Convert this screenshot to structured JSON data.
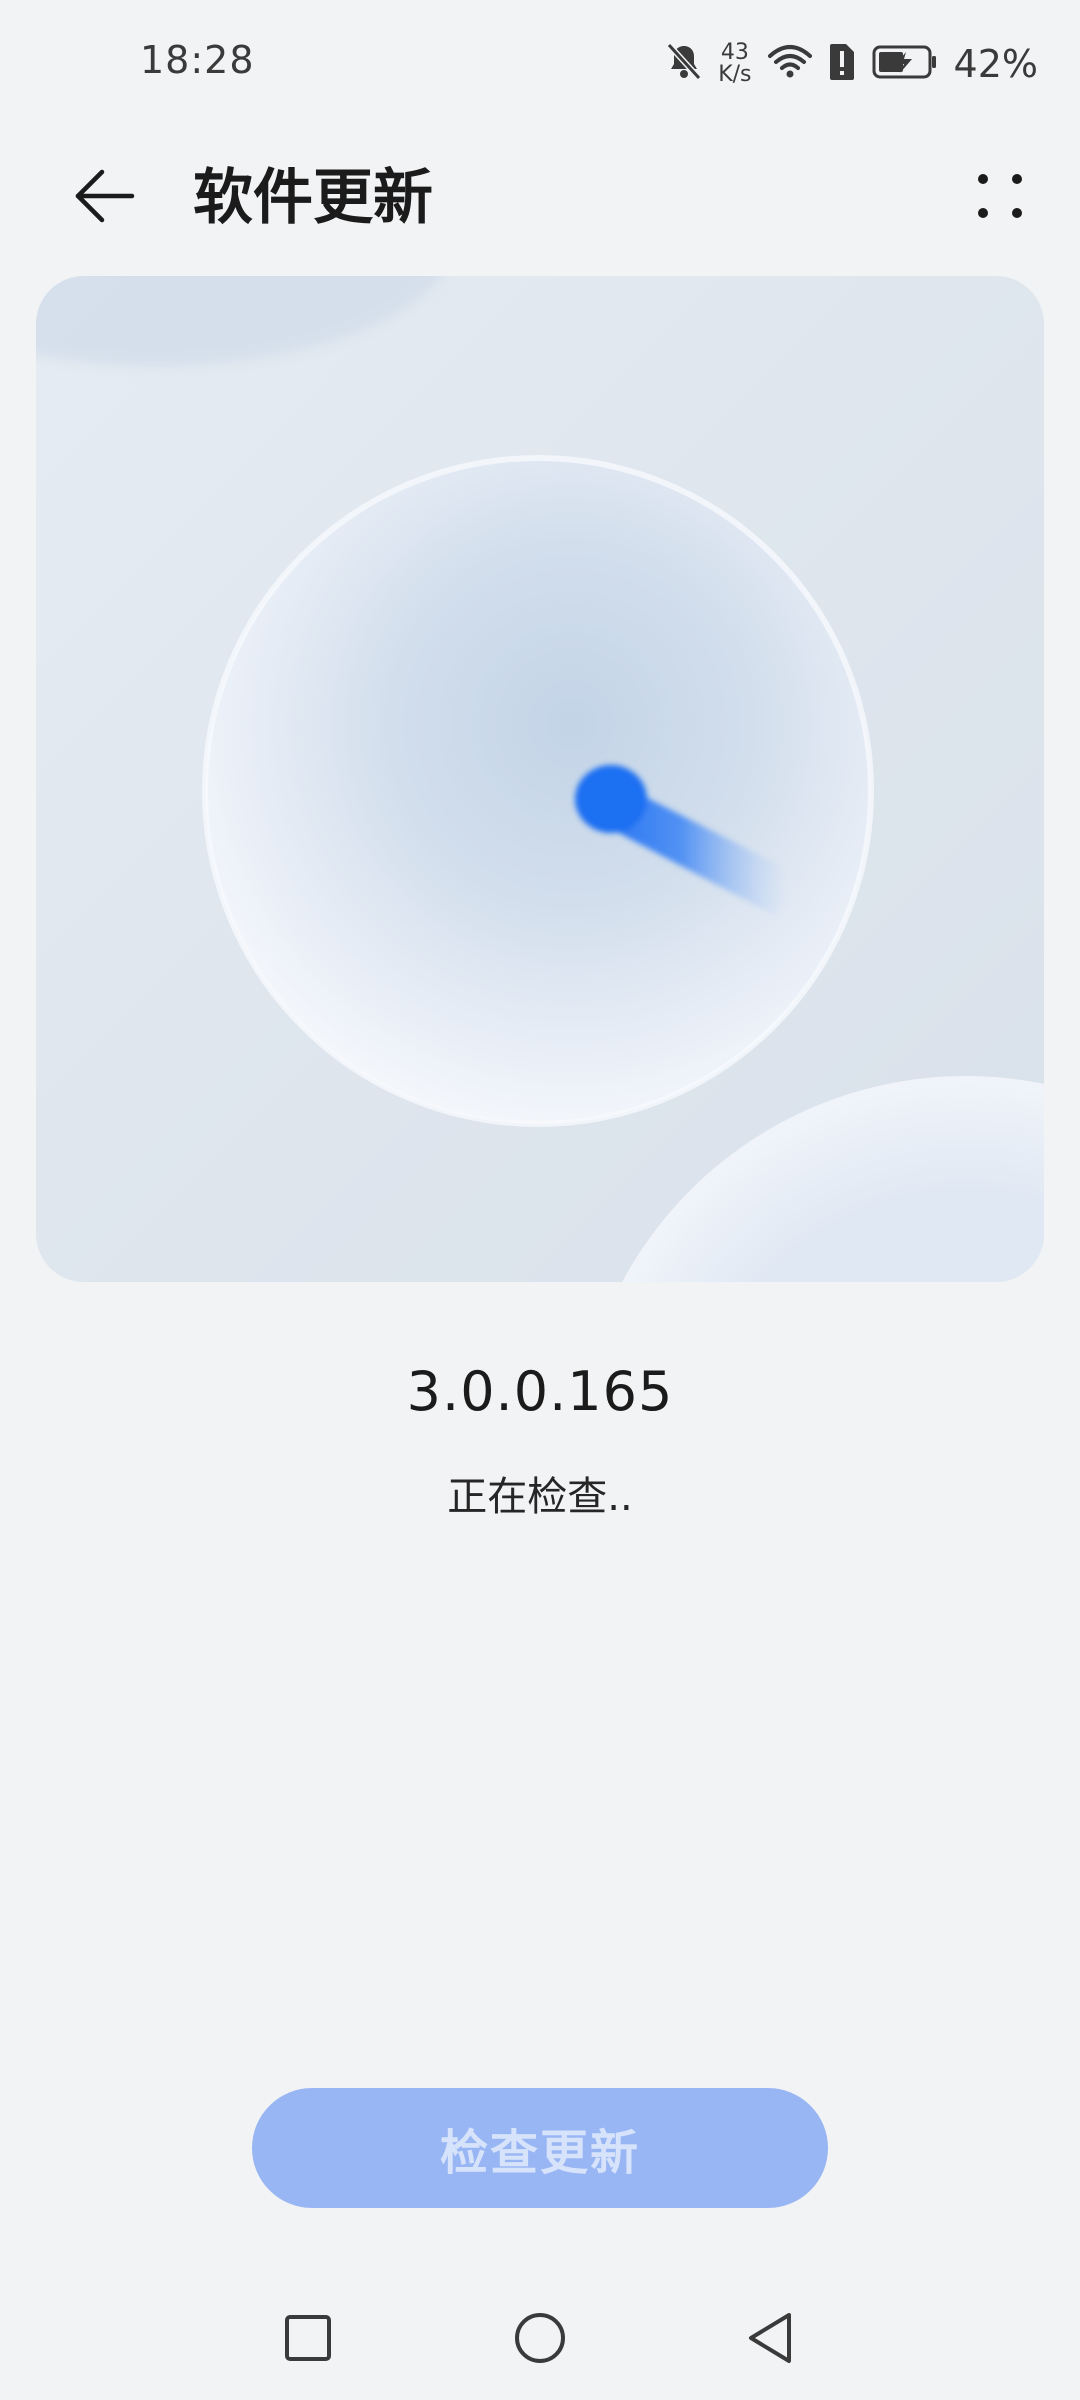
{
  "status_bar": {
    "time": "18:28",
    "net_speed_value": "43",
    "net_speed_unit": "K/s",
    "battery_percent": "42%",
    "icons": [
      "bell-muted-icon",
      "wifi-icon",
      "sim-alert-icon",
      "battery-charging-icon"
    ]
  },
  "app_bar": {
    "title": "软件更新",
    "back_icon": "arrow-left-icon",
    "more_icon": "more-dots-icon"
  },
  "hero": {
    "illustration": "update-checking-sphere",
    "accent_color": "#1f6ff2"
  },
  "update_info": {
    "version": "3.0.0.165",
    "status": "正在检查.."
  },
  "actions": {
    "check_update_label": "检查更新",
    "button_color": "#99b6f4",
    "button_text_color": "#d7e3fb",
    "button_enabled": false
  },
  "nav_bar": {
    "icons": [
      "recent-apps-square-icon",
      "home-circle-icon",
      "back-triangle-icon"
    ]
  }
}
